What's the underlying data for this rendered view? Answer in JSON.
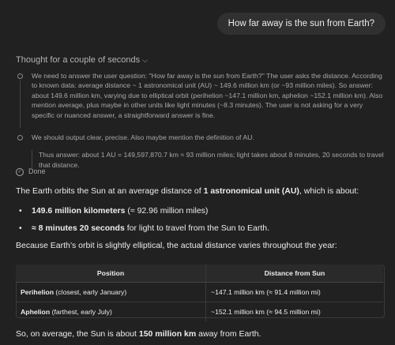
{
  "user_message": "How far away is the sun from Earth?",
  "thought": {
    "header": "Thought for a couple of seconds",
    "step1": "We need to answer the user question: \"How far away is the sun from Earth?\" The user asks the distance. According to known data: average distance ~ 1 astronomical unit (AU) ~ 149.6 million km (or ~93 million miles). So answer: about 149.6 million km, varying due to elliptical orbit (perihelion ~147.1 million km, aphelion ~152.1 million km). Also mention average, plus maybe in other units like light minutes (~8.3 minutes). The user is not asking for a very specific or nuanced answer, a straightforward answer is fine.",
    "step2": "We should output clear, precise. Also maybe mention the definition of AU.",
    "quote": "Thus answer: about 1 AU = 149,597,870.7 km ≈ 93 million miles; light takes about 8 minutes, 20 seconds to travel that distance.",
    "done": "Done"
  },
  "answer": {
    "intro_pre": "The Earth orbits the Sun at an average distance of ",
    "intro_bold": "1 astronomical unit (AU)",
    "intro_post": ", which is about:",
    "bullet1_bold": "149.6 million kilometers",
    "bullet1_rest": " (≈ 92.96 million miles)",
    "bullet2_bold": "≈ 8 minutes 20 seconds",
    "bullet2_rest": " for light to travel from the Sun to Earth.",
    "elliptical": "Because Earth’s orbit is slightly elliptical, the actual distance varies throughout the year:",
    "final_pre": "So, on average, the Sun is about ",
    "final_bold": "150 million km",
    "final_post": " away from Earth."
  },
  "table": {
    "headers": [
      "Position",
      "Distance from Sun"
    ],
    "rows": [
      {
        "bold": "Perihelion",
        "rest": " (closest, early January)",
        "distance": "~147.1 million km (≈ 91.4 million mi)"
      },
      {
        "bold": "Aphelion",
        "rest": " (farthest, early July)",
        "distance": "~152.1 million km (≈ 94.5 million mi)"
      }
    ]
  }
}
